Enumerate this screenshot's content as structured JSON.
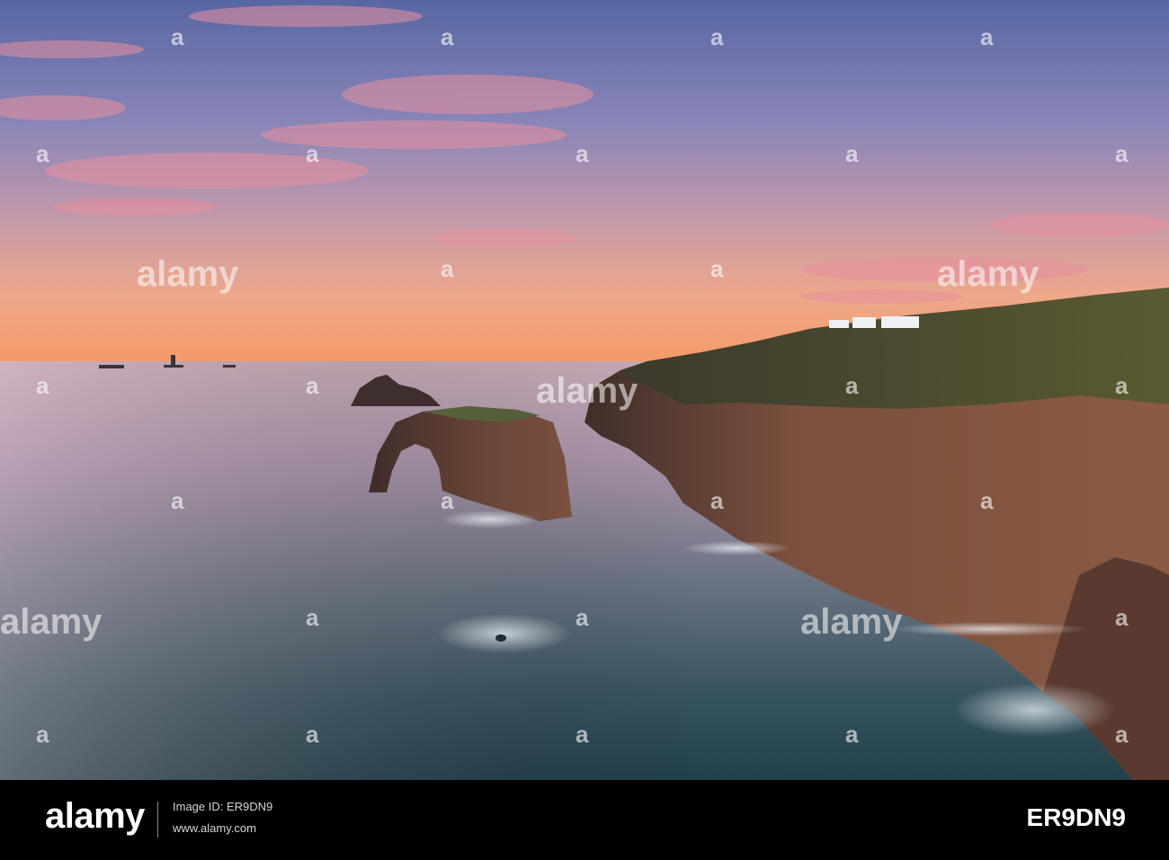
{
  "watermark": {
    "text": "alamy",
    "glyph": "a"
  },
  "footer": {
    "logo": "alamy",
    "reference_line": "Image ID: ER9DN9",
    "url": "www.alamy.com",
    "image_id": "ER9DN9"
  },
  "colors": {
    "sky_top": "#5d6aa6",
    "sky_mid": "#c48aa8",
    "horizon_glow": "#f2a070",
    "sea_far": "#c4aab8",
    "sea_near": "#2c4c56",
    "cliff": "#6e4a3c",
    "footer_bg": "#000000"
  }
}
